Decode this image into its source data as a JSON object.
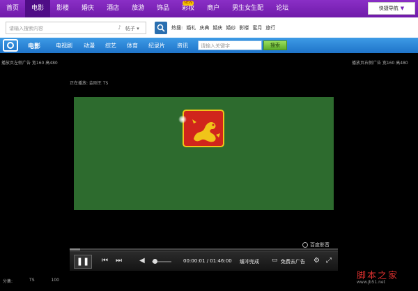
{
  "topnav": {
    "items": [
      "首页",
      "电影",
      "影楼",
      "婚庆",
      "酒店",
      "旅游",
      "饰品",
      "彩妆",
      "商户",
      "男生女生配",
      "论坛"
    ],
    "active_index": 1,
    "new_badge": "NEW",
    "quick_nav": "快捷导航"
  },
  "search": {
    "placeholder": "请输入搜索内容",
    "scope": "帖子",
    "hot_label": "热搜:",
    "hot_items": [
      "婚礼",
      "庆典",
      "婚庆",
      "婚纱",
      "影楼",
      "蜜月",
      "旅行"
    ]
  },
  "video_nav": {
    "items": [
      "电影",
      "电视剧",
      "动漫",
      "综艺",
      "体育",
      "纪录片",
      "资讯"
    ],
    "search_placeholder": "请输入关键字",
    "search_button": "搜索"
  },
  "ads": {
    "left": "播放页左侧广告 宽160 高480",
    "right": "播放页右侧广告 宽160 高480",
    "now_playing": "正在播放: 金刚王 TS"
  },
  "player": {
    "brand": "百度影音",
    "current_time": "00:00:01",
    "total_time": "01:46:00",
    "time_sep": "/",
    "quality_text": "缓冲完成",
    "no_ad_text": "免费去广告",
    "progress": 0.04,
    "volume": 0.1
  },
  "footer": {
    "score_label": "分集:",
    "score_a": "TS",
    "score_b": "100"
  },
  "watermark": {
    "text": "脚本之家",
    "url": "www.jb51.net"
  },
  "colors": {
    "topnav": "#7a25b8",
    "video_nav": "#2a84d8",
    "screen": "#2d6b2e",
    "logo_red": "#d0251c",
    "logo_gold": "#f0c419"
  }
}
